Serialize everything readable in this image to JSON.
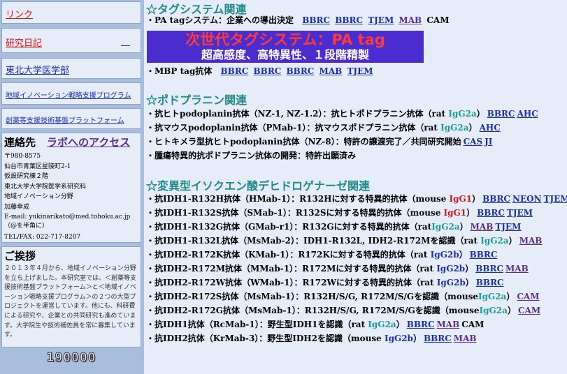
{
  "sidebar": {
    "link1": "リンク",
    "link2": "研究日記",
    "link2_extra": "＿",
    "link3": "東北大学医学部",
    "link4": "地域イノベーション戦略支援プログラム",
    "link5": "創薬等支援技術基盤プラットフォーム",
    "contact_title": "連絡先",
    "access_link": "ラボへのアクセス",
    "contact_lines": [
      "〒980-8575",
      "仙台市青葉区星陵町2-1",
      "仮設研究棟２階",
      "東北大学大学院医学系研究科",
      "地域イノベーション分野",
      "加藤幸成",
      "E-mail: yukinarikato@med.tohoku.ac.jp（@を半角に）",
      "TEL/FAX: 022-717-8207"
    ],
    "greeting_title": "ご挨拶",
    "greeting_text": "２０１３年４月から、地域イノベーション分野を立ち上げました。本研究室では、＜創薬等支援技術基盤プラットフォーム＞と＜地域イノベーション戦略支援プログラム＞の２つの大型プロジェクトを運営しています。他にも、科研費による研究や、企業との共同研究も進めています。大学院生や技術補佐員を常に募集しています。",
    "counter": "190000"
  },
  "main": {
    "sec1": "☆タグシステム関連",
    "pa_row": {
      "text": "・PA tagシステム：企業への導出決定",
      "links": [
        "BBRC",
        "BBRC",
        "TJEM",
        "MAB"
      ],
      "tail": "CAM"
    },
    "banner_line1": "次世代タグシステム：PA tag",
    "banner_line2": "超高感度、高特異性、１段階精製",
    "mbp_row": {
      "text": "・MBP tag抗体",
      "links": [
        "BBRC",
        "BBRC",
        "BBRC",
        "MAB",
        "TJEM"
      ]
    },
    "sec2": "☆ポドプラニン関連",
    "podo_rows": [
      {
        "pre": "・抗ヒトpodoplanin抗体（NZ-1, NZ-1.2）：抗ヒトポドプラニン抗体（rat ",
        "ig": "IgG2a",
        "post": "）",
        "links": [
          "BBRC",
          "AHC"
        ]
      },
      {
        "pre": "・抗マウスpodoplanin抗体（PMab-1）：抗マウスポドプラニン抗体（rat ",
        "ig": "IgG2a",
        "post": "）",
        "links": [
          "AHC"
        ]
      },
      {
        "pre": "・ヒトキメラ型抗ヒトpodoplanin抗体（NZ-8）：特許の譲渡完了／共同研究開始",
        "ig": "",
        "post": "",
        "links": [
          "CAS",
          "JI"
        ]
      },
      {
        "pre": "・腫瘍特異的抗ポドプラニン抗体の開発：特許出願済み",
        "ig": "",
        "post": "",
        "links": []
      }
    ],
    "sec3": "☆変異型イソクエン酸デヒドロゲナーゼ関連",
    "idh_rows": [
      {
        "pre": "・抗IDH1-R132H抗体（HMab-1）：R132Hに対する特異的抗体（mouse ",
        "ig": "IgG1",
        "igc": "red",
        "post": "）",
        "links": [
          "BBRC",
          "NEON",
          "TJEM"
        ],
        "tail": ""
      },
      {
        "pre": "・抗IDH1-R132S抗体（SMab-1）：R132Sに対する特異的抗体（mouse ",
        "ig": "IgG1",
        "igc": "red",
        "post": "）",
        "links": [
          "BBRC",
          "TJEM"
        ],
        "tail": ""
      },
      {
        "pre": "・抗IDH1-R132G抗体（GMab-r1）：R132Gに対する特異的抗体（rat",
        "ig": "IgG2a",
        "igc": "teal",
        "post": "）",
        "links": [
          "MAB",
          "TJEM"
        ],
        "tail": ""
      },
      {
        "pre": "・抗IDH1-R132L抗体（MsMab-2）：IDH1-R132L, IDH2-R172Mを認識（rat ",
        "ig": "IgG2a",
        "igc": "teal",
        "post": "）",
        "links": [
          "MAB"
        ],
        "tail": ""
      },
      {
        "pre": "・抗IDH2-R172K抗体（KMab-1）：R172Kに対する特異的抗体（rat ",
        "ig": "IgG2b",
        "igc": "blue",
        "post": "）",
        "links": [
          "BBRC"
        ],
        "tail": ""
      },
      {
        "pre": "・抗IDH2-R172M抗体（MMab-1）：R172Mに対する特異的抗体（rat ",
        "ig": "IgG2b",
        "igc": "blue",
        "post": "）",
        "links": [
          "BBRC",
          "MAB"
        ],
        "tail": ""
      },
      {
        "pre": "・抗IDH2-R172W抗体（WMab-1）：R172Wに対する特異的抗体（rat ",
        "ig": "IgG2b",
        "igc": "blue",
        "post": "）",
        "links": [
          "BBRC"
        ],
        "tail": ""
      },
      {
        "pre": "・抗IDH2-R172S抗体（MsMab-1）：R132H/S/G, R172M/S/Gを認識（mouse",
        "ig": "IgG2a",
        "igc": "teal",
        "post": "）",
        "links": [
          "CAM"
        ],
        "tail": ""
      },
      {
        "pre": "・抗IDH2-R172G抗体（MsMab-1）：R132H/S/G, R172M/S/Gを認識（mouse",
        "ig": "IgG2a",
        "igc": "teal",
        "post": "）",
        "links": [
          "CAM"
        ],
        "tail": ""
      },
      {
        "pre": "・抗IDH1抗体（RcMab-1）：野生型IDH1を認識（rat ",
        "ig": "IgG2a",
        "igc": "teal",
        "post": "）",
        "links": [
          "BBRC",
          "MAB"
        ],
        "tail": "CAM"
      },
      {
        "pre": "・抗IDH2抗体（KrMab-3）：野生型IDH2を認識（mouse ",
        "ig": "IgG2b",
        "igc": "blue",
        "post": "）",
        "links": [
          "BBRC",
          "MAB"
        ],
        "tail": ""
      }
    ]
  }
}
